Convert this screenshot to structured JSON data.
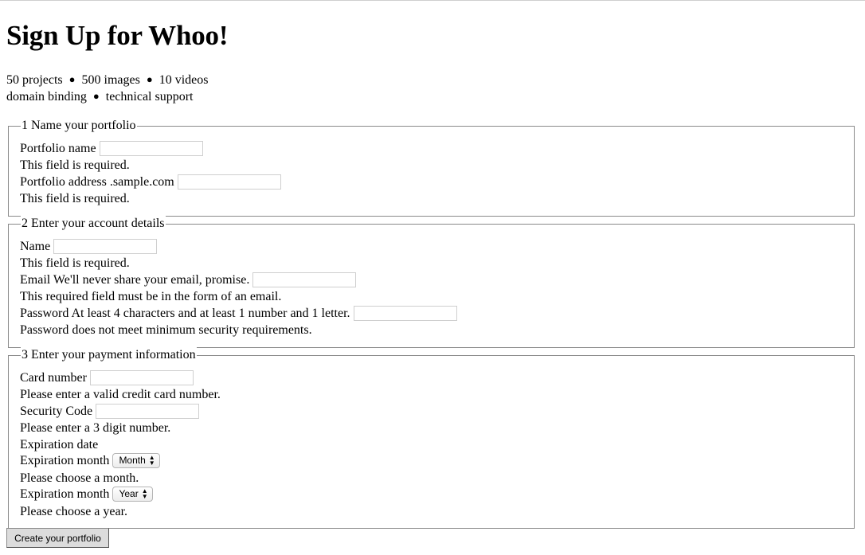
{
  "page": {
    "title": "Sign Up for Whoo!",
    "features": {
      "line1": [
        "50 projects",
        "500 images",
        "10 videos"
      ],
      "line2": [
        "domain binding",
        "technical support"
      ],
      "separator": "●"
    }
  },
  "sections": {
    "portfolio": {
      "legend": "1 Name your portfolio",
      "name_label": "Portfolio name",
      "name_error": "This field is required.",
      "address_label": "Portfolio address .sample.com",
      "address_error": "This field is required."
    },
    "account": {
      "legend": "2 Enter your account details",
      "name_label": "Name",
      "name_error": "This field is required.",
      "email_label": "Email We'll never share your email, promise.",
      "email_error": "This required field must be in the form of an email.",
      "password_label": "Password At least 4 characters and at least 1 number and 1 letter.",
      "password_error": "Password does not meet minimum security requirements."
    },
    "payment": {
      "legend": "3 Enter your payment information",
      "card_label": "Card number",
      "card_error": "Please enter a valid credit card number.",
      "security_label": "Security Code",
      "security_error": "Please enter a 3 digit number.",
      "expiration_heading": "Expiration date",
      "month_label": "Expiration month",
      "month_select": "Month",
      "month_error": "Please choose a month.",
      "year_label": "Expiration month",
      "year_select": "Year",
      "year_error": "Please choose a year."
    }
  },
  "submit_label": "Create your portfolio"
}
